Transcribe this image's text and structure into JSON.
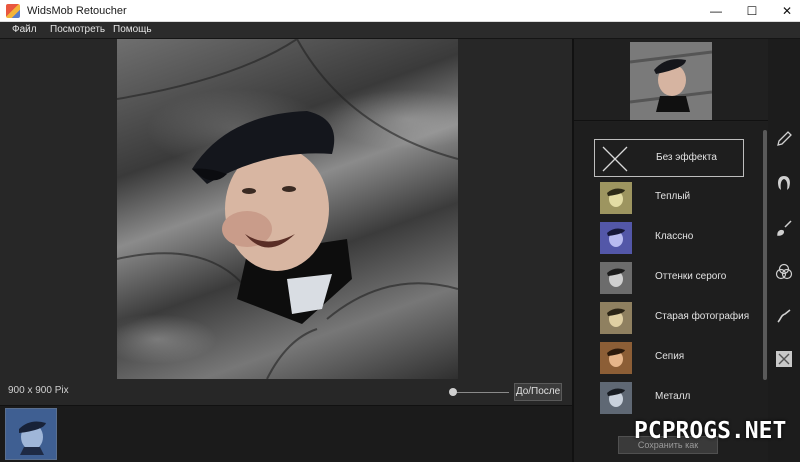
{
  "window": {
    "title": "WidsMob Retoucher",
    "minimize": "—",
    "maximize": "☐",
    "close": "✕"
  },
  "menu": {
    "file": "Файл",
    "view": "Посмотреть",
    "help": "Помощь"
  },
  "canvas": {
    "size_label": "900 x 900 Pix",
    "before_after": "До/После",
    "zoom_level": 0
  },
  "effects": [
    {
      "label": "Без эффекта",
      "tint": "none",
      "selected": true
    },
    {
      "label": "Теплый",
      "tint": "#b9b06a"
    },
    {
      "label": "Классно",
      "tint": "#6f73c8"
    },
    {
      "label": "Оттенки серого",
      "tint": "#8a8a8a"
    },
    {
      "label": "Старая фотография",
      "tint": "#b7a57a"
    },
    {
      "label": "Сепия",
      "tint": "#b07a4a"
    },
    {
      "label": "Металл",
      "tint": "#7c8898"
    }
  ],
  "tools": [
    "pencil-icon",
    "hair-icon",
    "brush-icon",
    "color-circles-icon",
    "smudge-icon",
    "effects-icon"
  ],
  "footer": {
    "save_button": "Сохранить как",
    "watermark": "PCPROGS.NET"
  }
}
